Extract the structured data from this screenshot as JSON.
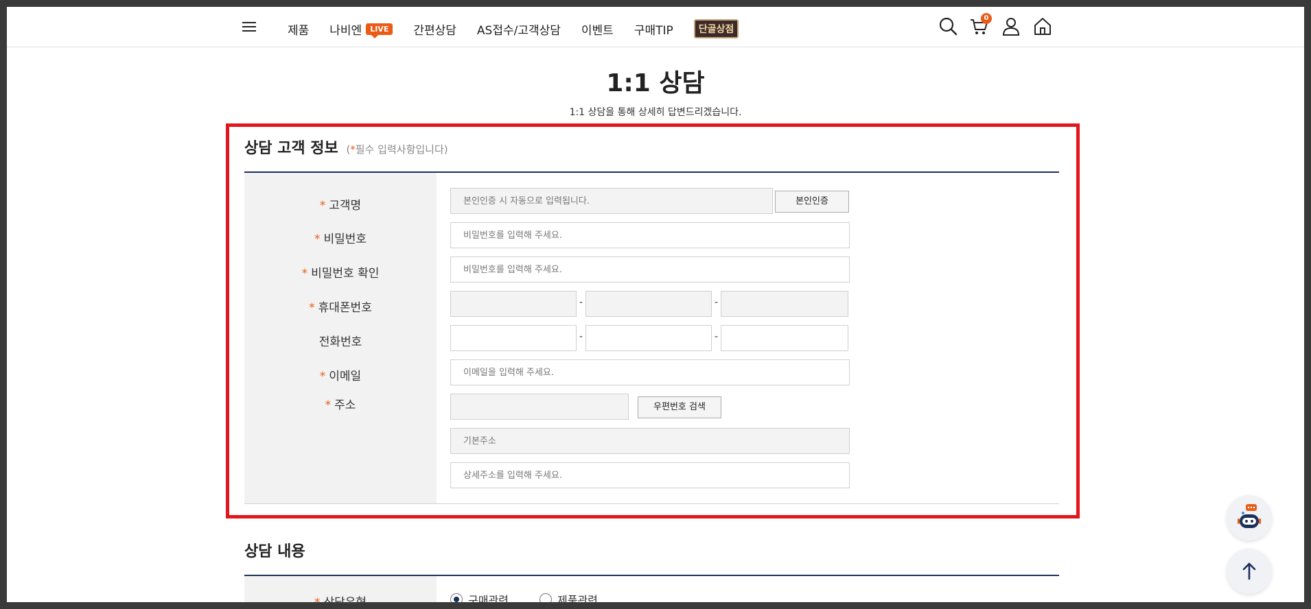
{
  "header": {
    "nav": [
      "제품",
      "나비엔",
      "간편상담",
      "AS접수/고객상담",
      "이벤트",
      "구매TIP"
    ],
    "live_badge": "LIVE",
    "special_badge": "단골상점",
    "cart_count": "0",
    "icons": [
      "menu-icon",
      "search-icon",
      "cart-icon",
      "user-icon",
      "home-icon"
    ]
  },
  "page": {
    "title": "1:1 상담",
    "subtitle": "1:1 상담을 통해 상세히 답변드리겠습니다."
  },
  "customer_section": {
    "title": "상담 고객 정보",
    "note_open": "(",
    "note_star": "*",
    "note_text": "필수 입력사항입니다)",
    "required_mark": "*",
    "labels": {
      "name": "고객명",
      "password": "비밀번호",
      "password_confirm": "비밀번호 확인",
      "mobile": "휴대폰번호",
      "phone": "전화번호",
      "email": "이메일",
      "address": "주소"
    },
    "placeholders": {
      "name": "본인인증 시 자동으로 입력됩니다.",
      "password": "비밀번호를 입력해 주세요.",
      "password_confirm": "비밀번호를 입력해 주세요.",
      "email": "이메일을 입력해 주세요.",
      "address_basic": "기본주소",
      "address_detail": "상세주소를 입력해 주세요."
    },
    "dash": "-",
    "buttons": {
      "verify": "본인인증",
      "zip_search": "우편번호 검색"
    }
  },
  "consult_section": {
    "title": "상담 내용",
    "type_label": "상담유형",
    "options": [
      "구매관련",
      "제품관련"
    ],
    "selected": "구매관련"
  },
  "colors": {
    "accent": "#ea5b16",
    "navy": "#1b2f5c",
    "highlight": "#e3161d"
  }
}
